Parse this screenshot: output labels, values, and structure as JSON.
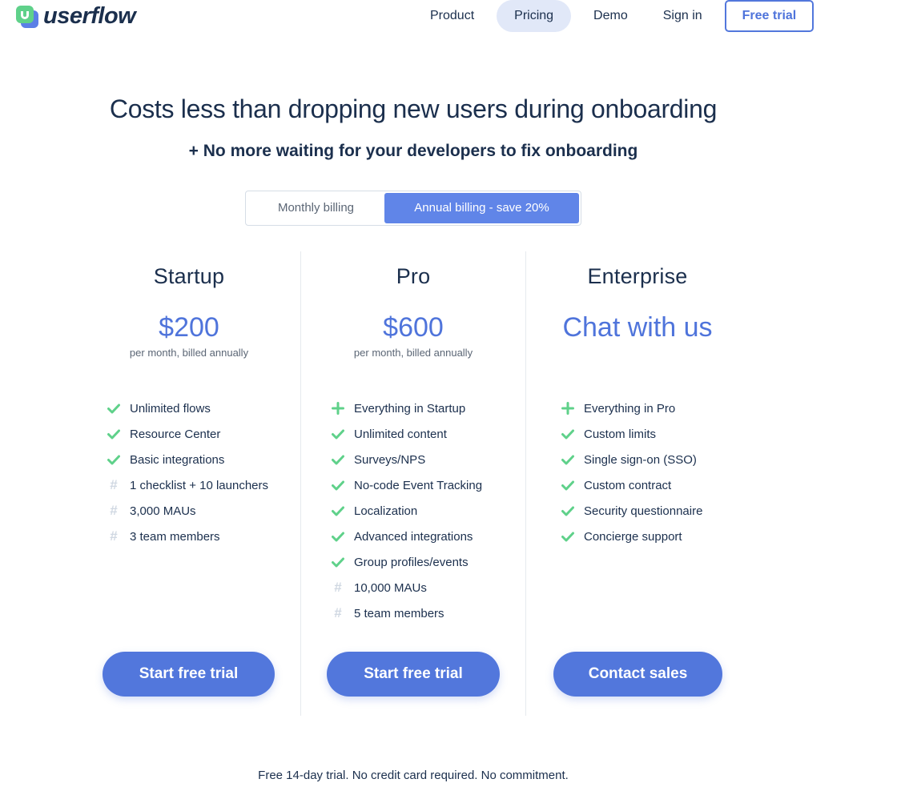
{
  "header": {
    "brand": "userflow",
    "nav": [
      {
        "label": "Product",
        "active": false
      },
      {
        "label": "Pricing",
        "active": true
      },
      {
        "label": "Demo",
        "active": false
      },
      {
        "label": "Sign in",
        "active": false
      }
    ],
    "cta_label": "Free trial"
  },
  "hero": {
    "headline": "Costs less than dropping new users during onboarding",
    "subhead": "+ No more waiting for your developers to fix onboarding"
  },
  "billing_toggle": {
    "options": [
      "Monthly billing",
      "Annual billing - save 20%"
    ],
    "selected": "Annual billing - save 20%"
  },
  "plans": [
    {
      "name": "Startup",
      "price": "$200",
      "price_note": "per month, billed annually",
      "features": [
        {
          "icon": "check-icon",
          "text": "Unlimited flows"
        },
        {
          "icon": "check-icon",
          "text": "Resource Center"
        },
        {
          "icon": "check-icon",
          "text": "Basic integrations"
        },
        {
          "icon": "hash-icon",
          "text": "1 checklist + 10 launchers"
        },
        {
          "icon": "hash-icon",
          "text": "3,000 MAUs"
        },
        {
          "icon": "hash-icon",
          "text": "3 team members"
        }
      ],
      "cta": "Start free trial"
    },
    {
      "name": "Pro",
      "price": "$600",
      "price_note": "per month, billed annually",
      "features": [
        {
          "icon": "plus-icon",
          "text": "Everything in Startup"
        },
        {
          "icon": "check-icon",
          "text": "Unlimited content"
        },
        {
          "icon": "check-icon",
          "text": "Surveys/NPS"
        },
        {
          "icon": "check-icon",
          "text": "No-code Event Tracking"
        },
        {
          "icon": "check-icon",
          "text": "Localization"
        },
        {
          "icon": "check-icon",
          "text": "Advanced integrations"
        },
        {
          "icon": "check-icon",
          "text": "Group profiles/events"
        },
        {
          "icon": "hash-icon",
          "text": "10,000 MAUs"
        },
        {
          "icon": "hash-icon",
          "text": "5 team members"
        }
      ],
      "cta": "Start free trial"
    },
    {
      "name": "Enterprise",
      "price": "Chat with us",
      "price_note": "",
      "features": [
        {
          "icon": "plus-icon",
          "text": "Everything in Pro"
        },
        {
          "icon": "check-icon",
          "text": "Custom limits"
        },
        {
          "icon": "check-icon",
          "text": "Single sign-on (SSO)"
        },
        {
          "icon": "check-icon",
          "text": "Custom contract"
        },
        {
          "icon": "check-icon",
          "text": "Security questionnaire"
        },
        {
          "icon": "check-icon",
          "text": "Concierge support"
        }
      ],
      "cta": "Contact sales"
    }
  ],
  "footnote": "Free 14-day trial. No credit card required. No commitment.",
  "colors": {
    "brand_blue": "#5277dc",
    "brand_green": "#5fd18a",
    "text_dark": "#1b2f4d",
    "muted": "#5b6675",
    "active_nav_bg": "#e1e8f8",
    "hash_gray": "#d0d8e2"
  }
}
